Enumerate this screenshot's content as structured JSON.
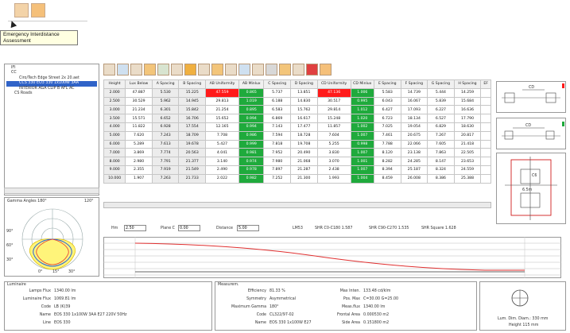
{
  "tooltip": {
    "line1": "Emergency Interdistance",
    "line2": "Assessment"
  },
  "tree": {
    "items": [
      "IFI",
      "CC",
      "Ciro/Tech Edge Street 2x 20.aet",
      "CCS 330 EO3 330 1x100W 3AA",
      "INTERIOR AGA CLIP B AFL AC",
      "CS Roads"
    ]
  },
  "table": {
    "headers": [
      "Height",
      "Lux Below",
      "A Spacing",
      "B Spacing",
      "AB Uniformity",
      "AB Minlux",
      "C Spacing",
      "D Spacing",
      "CD Uniformity",
      "CD Minlux",
      "E Spacing",
      "F Spacing",
      "G Spacing",
      "H Spacing",
      "EF"
    ],
    "rows": [
      [
        "2.000",
        "47.887",
        "5.530",
        "15.225",
        "47.559",
        "0.865",
        "5.737",
        "13.851",
        "47.136",
        "1.006",
        "5.583",
        "14.739",
        "5.444",
        "14.259",
        ""
      ],
      [
        "2.500",
        "30.529",
        "5.962",
        "14.945",
        "29.813",
        "1.019",
        "6.188",
        "14.830",
        "30.517",
        "0.995",
        "6.043",
        "16.067",
        "5.839",
        "15.684",
        ""
      ],
      [
        "3.000",
        "21.234",
        "6.301",
        "15.842",
        "21.254",
        "0.895",
        "6.583",
        "15.762",
        "29.814",
        "1.012",
        "6.427",
        "17.093",
        "6.227",
        "16.636",
        ""
      ],
      [
        "3.500",
        "15.571",
        "6.652",
        "16.706",
        "15.652",
        "0.994",
        "6.869",
        "16.617",
        "15.248",
        "1.020",
        "6.723",
        "18.134",
        "6.527",
        "17.790",
        ""
      ],
      [
        "4.000",
        "11.822",
        "6.928",
        "17.554",
        "12.165",
        "0.994",
        "7.143",
        "17.477",
        "11.857",
        "1.002",
        "7.025",
        "19.054",
        "6.829",
        "18.630",
        ""
      ],
      [
        "5.000",
        "7.620",
        "7.243",
        "18.709",
        "7.708",
        "0.986",
        "7.594",
        "18.728",
        "7.604",
        "1.007",
        "7.461",
        "20.675",
        "7.267",
        "20.817",
        ""
      ],
      [
        "6.000",
        "5.289",
        "7.613",
        "19.678",
        "5.427",
        "0.999",
        "7.818",
        "19.708",
        "5.255",
        "0.998",
        "7.788",
        "22.066",
        "7.605",
        "21.418",
        ""
      ],
      [
        "7.000",
        "3.869",
        "7.774",
        "20.563",
        "4.041",
        "0.981",
        "7.952",
        "20.490",
        "3.830",
        "1.007",
        "8.120",
        "23.138",
        "7.863",
        "22.505",
        ""
      ],
      [
        "8.000",
        "2.980",
        "7.791",
        "21.377",
        "3.140",
        "0.974",
        "7.980",
        "21.068",
        "3.070",
        "1.001",
        "8.282",
        "24.285",
        "8.147",
        "23.653",
        ""
      ],
      [
        "9.000",
        "2.355",
        "7.919",
        "21.549",
        "2.490",
        "0.978",
        "7.897",
        "21.287",
        "2.438",
        "1.007",
        "8.394",
        "25.187",
        "8.324",
        "24.559",
        ""
      ],
      [
        "10.000",
        "1.907",
        "7.263",
        "21.733",
        "2.022",
        "0.982",
        "7.252",
        "21.300",
        "1.993",
        "1.004",
        "8.459",
        "26.008",
        "8.386",
        "25.388",
        ""
      ]
    ]
  },
  "params": {
    "hm_label": "Hm",
    "hm_value": "2.50",
    "plane_label": "Plane C",
    "plane_value": "0.00",
    "distance_label": "Distance",
    "distance_value": "5.00",
    "lm53": "LM53",
    "shr1": "SHR C0-C180 1.587",
    "shr2": "SHR C90-C270 1.535",
    "shr3": "SHR Square 1.628"
  },
  "polar": {
    "title": "Gamma Angles 180°",
    "right_label": "120°",
    "labels": [
      "90°",
      "60°",
      "30°",
      "0°",
      "15°",
      "30°"
    ]
  },
  "luminaire": {
    "title": "Luminaire",
    "rows": [
      [
        "Lamps Flux",
        "1340.00 lm"
      ],
      [
        "Luminaire Flux",
        "1069.81 lm"
      ],
      [
        "Code",
        "LB (K)39"
      ],
      [
        "Name",
        "EOS 330 1x100W 3AA E27 220V 50Hz"
      ],
      [
        "Line",
        "EOS 330"
      ]
    ]
  },
  "measurements": {
    "title": "Measurem.",
    "rows": [
      [
        "Efficiency",
        "81.33 %"
      ],
      [
        "Symmetry",
        "Asymmetrical"
      ],
      [
        "Maximum Gamma",
        "180°"
      ],
      [
        "Code",
        "CL322/97-02"
      ],
      [
        "Name",
        "EOS 330 1x100W E27"
      ]
    ],
    "right_rows": [
      [
        "Max Inten.",
        "133.48 cd/klm"
      ],
      [
        "Pos. Max",
        "C=30.00 G=25.00"
      ],
      [
        "Meas.flux",
        "1340.00 lm"
      ],
      [
        "Frontal Area",
        "0.000530 m2"
      ],
      [
        "Side Area",
        "0.151800 m2"
      ]
    ]
  },
  "dims": {
    "line1": "Lum. Dim. Diam.: 330 mm",
    "line2": "Height 115 mm"
  },
  "diagrams": {
    "d1_label": "CD",
    "d2_label": "CD",
    "d3_label1": "C6",
    "d3_label2": "6.5m"
  },
  "colors": {
    "red": "#ff1a1a",
    "green": "#1faa3c",
    "curve": "#e03030"
  }
}
